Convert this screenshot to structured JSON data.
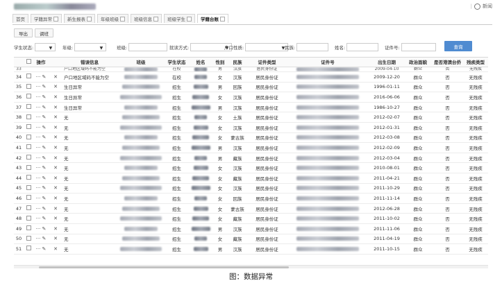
{
  "header": {
    "right_text": "新闻"
  },
  "tabs": [
    {
      "label": "首页",
      "closable": false,
      "active": false
    },
    {
      "label": "学籍异常",
      "closable": true,
      "active": false
    },
    {
      "label": "新生报表",
      "closable": true,
      "active": false
    },
    {
      "label": "年级班级",
      "closable": true,
      "active": false
    },
    {
      "label": "班级信息",
      "closable": true,
      "active": false
    },
    {
      "label": "班级学生",
      "closable": true,
      "active": false
    },
    {
      "label": "学籍台账",
      "closable": true,
      "active": true
    }
  ],
  "toolbar": {
    "export_label": "导出",
    "adjust_label": "调班"
  },
  "filters": {
    "student_status_label": "学生状态:",
    "grade_label": "年级:",
    "class_label": "班级:",
    "study_mode_label": "就读方式:",
    "hukou_label": "户口性质:",
    "ethnicity_label": "民族:",
    "name_label": "姓名:",
    "id_label": "证件号:",
    "query_label": "查询"
  },
  "columns": [
    "",
    "",
    "操作",
    "",
    "错误信息",
    "班级",
    "学生状态",
    "姓名",
    "性别",
    "民族",
    "证件类型",
    "证件号",
    "出生日期",
    "政治面貌",
    "是否港澳台侨",
    "残疾类型"
  ],
  "partial_row": {
    "num": "33",
    "error": "户口地区域码不能为空",
    "status": "在校",
    "gender": "男",
    "ethnicity": "汉族",
    "id_type": "居民身份证",
    "birth": "2009-04-10",
    "political": "群众",
    "hmt": "否",
    "disability": "无残疾"
  },
  "rows": [
    {
      "num": "34",
      "error": "户口地区域码不能为空",
      "status": "在校",
      "gender": "女",
      "ethnicity": "汉族",
      "id_type": "居民身份证",
      "birth": "2009-12-20",
      "political": "群众",
      "hmt": "否",
      "disability": "无残疾"
    },
    {
      "num": "35",
      "error": "生日异常",
      "status": "招生",
      "gender": "男",
      "ethnicity": "回族",
      "id_type": "居民身份证",
      "birth": "1996-01-11",
      "political": "群众",
      "hmt": "否",
      "disability": "无残疾"
    },
    {
      "num": "36",
      "error": "生日异常",
      "status": "招生",
      "gender": "女",
      "ethnicity": "汉族",
      "id_type": "居民身份证",
      "birth": "2016-06-06",
      "political": "群众",
      "hmt": "否",
      "disability": "无残疾"
    },
    {
      "num": "37",
      "error": "生日异常",
      "status": "招生",
      "gender": "男",
      "ethnicity": "汉族",
      "id_type": "居民身份证",
      "birth": "1986-10-27",
      "political": "群众",
      "hmt": "否",
      "disability": "无残疾"
    },
    {
      "num": "38",
      "error": "无",
      "status": "招生",
      "gender": "女",
      "ethnicity": "土族",
      "id_type": "居民身份证",
      "birth": "2012-02-07",
      "political": "群众",
      "hmt": "否",
      "disability": "无残疾"
    },
    {
      "num": "39",
      "error": "无",
      "status": "招生",
      "gender": "女",
      "ethnicity": "汉族",
      "id_type": "居民身份证",
      "birth": "2012-01-31",
      "political": "群众",
      "hmt": "否",
      "disability": "无残疾"
    },
    {
      "num": "40",
      "error": "无",
      "status": "招生",
      "gender": "女",
      "ethnicity": "蒙古族",
      "id_type": "居民身份证",
      "birth": "2012-03-08",
      "political": "群众",
      "hmt": "否",
      "disability": "无残疾"
    },
    {
      "num": "41",
      "error": "无",
      "status": "招生",
      "gender": "男",
      "ethnicity": "汉族",
      "id_type": "居民身份证",
      "birth": "2012-02-09",
      "political": "群众",
      "hmt": "否",
      "disability": "无残疾"
    },
    {
      "num": "42",
      "error": "无",
      "status": "招生",
      "gender": "男",
      "ethnicity": "藏族",
      "id_type": "居民身份证",
      "birth": "2012-03-04",
      "political": "群众",
      "hmt": "否",
      "disability": "无残疾"
    },
    {
      "num": "43",
      "error": "无",
      "status": "招生",
      "gender": "女",
      "ethnicity": "汉族",
      "id_type": "居民身份证",
      "birth": "2010-08-01",
      "political": "群众",
      "hmt": "否",
      "disability": "无残疾"
    },
    {
      "num": "44",
      "error": "无",
      "status": "招生",
      "gender": "女",
      "ethnicity": "藏族",
      "id_type": "居民身份证",
      "birth": "2011-04-21",
      "political": "群众",
      "hmt": "否",
      "disability": "无残疾"
    },
    {
      "num": "45",
      "error": "无",
      "status": "招生",
      "gender": "女",
      "ethnicity": "汉族",
      "id_type": "居民身份证",
      "birth": "2011-10-29",
      "political": "群众",
      "hmt": "否",
      "disability": "无残疾"
    },
    {
      "num": "46",
      "error": "无",
      "status": "招生",
      "gender": "女",
      "ethnicity": "回族",
      "id_type": "居民身份证",
      "birth": "2011-11-14",
      "political": "群众",
      "hmt": "否",
      "disability": "无残疾"
    },
    {
      "num": "47",
      "error": "无",
      "status": "招生",
      "gender": "女",
      "ethnicity": "蒙古族",
      "id_type": "居民身份证",
      "birth": "2012-06-28",
      "political": "群众",
      "hmt": "否",
      "disability": "无残疾"
    },
    {
      "num": "48",
      "error": "无",
      "status": "招生",
      "gender": "女",
      "ethnicity": "藏族",
      "id_type": "居民身份证",
      "birth": "2011-10-02",
      "political": "群众",
      "hmt": "否",
      "disability": "无残疾"
    },
    {
      "num": "49",
      "error": "无",
      "status": "招生",
      "gender": "男",
      "ethnicity": "汉族",
      "id_type": "居民身份证",
      "birth": "2011-11-06",
      "political": "群众",
      "hmt": "否",
      "disability": "无残疾"
    },
    {
      "num": "50",
      "error": "无",
      "status": "招生",
      "gender": "女",
      "ethnicity": "藏族",
      "id_type": "居民身份证",
      "birth": "2011-04-19",
      "political": "群众",
      "hmt": "否",
      "disability": "无残疾"
    },
    {
      "num": "51",
      "error": "无",
      "status": "招生",
      "gender": "男",
      "ethnicity": "汉族",
      "id_type": "居民身份证",
      "birth": "2011-10-15",
      "political": "群众",
      "hmt": "否",
      "disability": "无残疾"
    }
  ],
  "icons": {
    "more": "more-dots-icon",
    "edit": "pencil-icon",
    "delete": "close-icon"
  },
  "caption": "图：数据异常",
  "colors": {
    "accent": "#4f8bd1"
  }
}
